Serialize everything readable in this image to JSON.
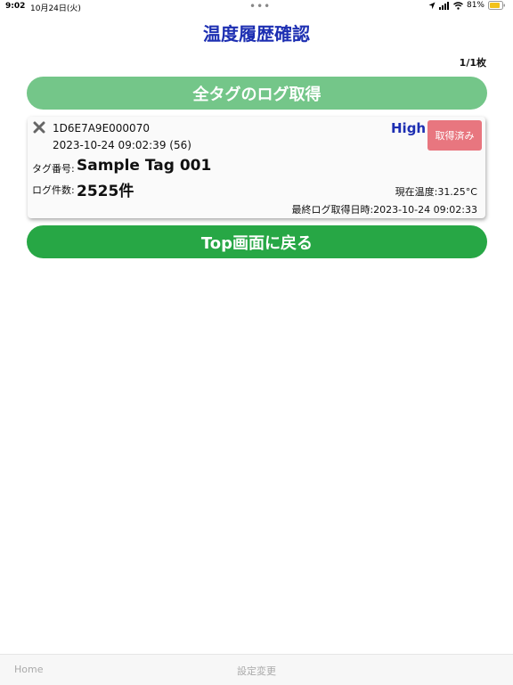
{
  "status_bar": {
    "time": "9:02",
    "date": "10月24日(火)",
    "dots": "•••",
    "battery": "81%"
  },
  "header": {
    "title": "温度履歴確認",
    "page_count": "1/1枚"
  },
  "actions": {
    "get_all_logs": "全タグのログ取得",
    "back_to_top": "Top画面に戻る"
  },
  "tags": [
    {
      "id": "1D6E7A9E000070",
      "datetime": "2023-10-24 09:02:39 (56)",
      "level": "High",
      "status_button": "取得済み",
      "tag_number_label": "タグ番号:",
      "tag_number": "Sample Tag 001",
      "log_count_label": "ログ件数:",
      "log_count": "2525件",
      "current_temp": "現在温度:31.25°C",
      "last_log_time": "最終ログ取得日時:2023-10-24 09:02:33"
    }
  ],
  "tab_bar": {
    "home": "Home",
    "settings": "設定変更"
  },
  "colors": {
    "title": "#1d2fb2",
    "get_all_button": "#74c689",
    "back_button": "#27a745",
    "status_button": "#e8767f",
    "battery": "#f2c21a"
  },
  "icons": [
    "location-arrow-icon",
    "signal-icon",
    "wifi-icon",
    "battery-icon",
    "close-icon"
  ]
}
